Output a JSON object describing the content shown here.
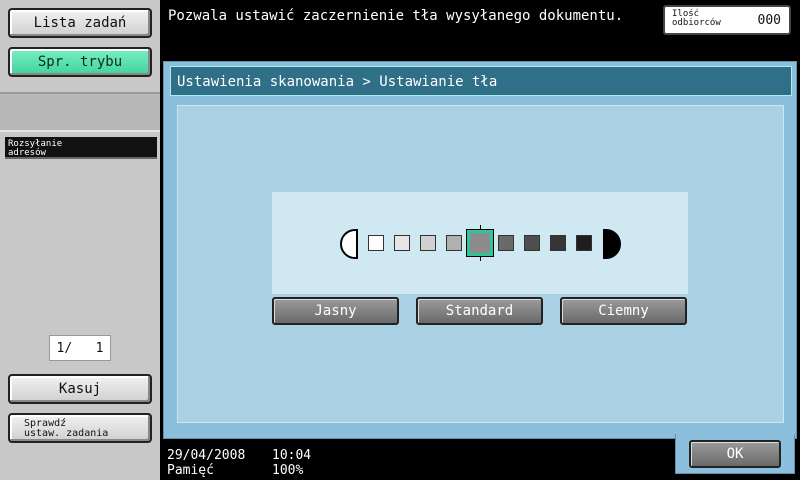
{
  "left": {
    "jobs_label": "Lista zadań",
    "mode_label": "Spr. trybu",
    "address_tab": "Rozsyłanie\nadresów",
    "page_counter": "1/   1",
    "clear_label": "Kasuj",
    "check_label": "Sprawdź\nustaw. zadania"
  },
  "top": {
    "message": "Pozwala ustawić zaczernienie tła wysyłanego dokumentu.",
    "recipients_label": "Ilość\nodbiorców",
    "recipients_value": "000"
  },
  "main": {
    "breadcrumb": "Ustawienia skanowania > Ustawianie tła",
    "density": {
      "steps": 9,
      "selected_step": 5,
      "colors": [
        "#ffffff",
        "#e6e6e6",
        "#d0d0d0",
        "#b0b0b0",
        "#8c8c8c",
        "#6a6a6a",
        "#4e4e4e",
        "#363636",
        "#1e1e1e"
      ]
    },
    "buttons": {
      "light": "Jasny",
      "standard": "Standard",
      "dark": "Ciemny"
    },
    "ok_label": "OK"
  },
  "status": {
    "date": "29/04/2008",
    "time": "10:04",
    "memory_label": "Pamięć",
    "memory_value": "100%"
  },
  "colors": {
    "mode_button": "#52dcae",
    "panel_blue": "#8cbfdc",
    "header_blue": "#2f6f87",
    "selection_green": "#2ec59a"
  }
}
